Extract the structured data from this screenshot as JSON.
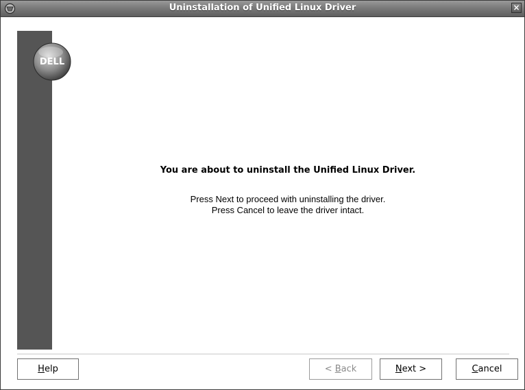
{
  "window": {
    "title": "Uninstallation of Unified Linux Driver",
    "close_glyph": "×",
    "menu_icon": "wm-menu-icon"
  },
  "sidebar": {
    "logo_text": "DELL"
  },
  "main": {
    "headline": "You are about to uninstall the Unified Linux Driver.",
    "line1": "Press Next to proceed with uninstalling the driver.",
    "line2": "Press Cancel to leave the driver intact."
  },
  "buttons": {
    "help": {
      "pre": "",
      "mnemonic": "H",
      "post": "elp",
      "enabled": true
    },
    "back": {
      "pre": "< ",
      "mnemonic": "B",
      "post": "ack",
      "enabled": false
    },
    "next": {
      "pre": "",
      "mnemonic": "N",
      "post": "ext >",
      "enabled": true
    },
    "cancel": {
      "pre": "",
      "mnemonic": "C",
      "post": "ancel",
      "enabled": true
    }
  },
  "colors": {
    "sidebar": "#555555",
    "titlebar": "#7a7a7a"
  }
}
